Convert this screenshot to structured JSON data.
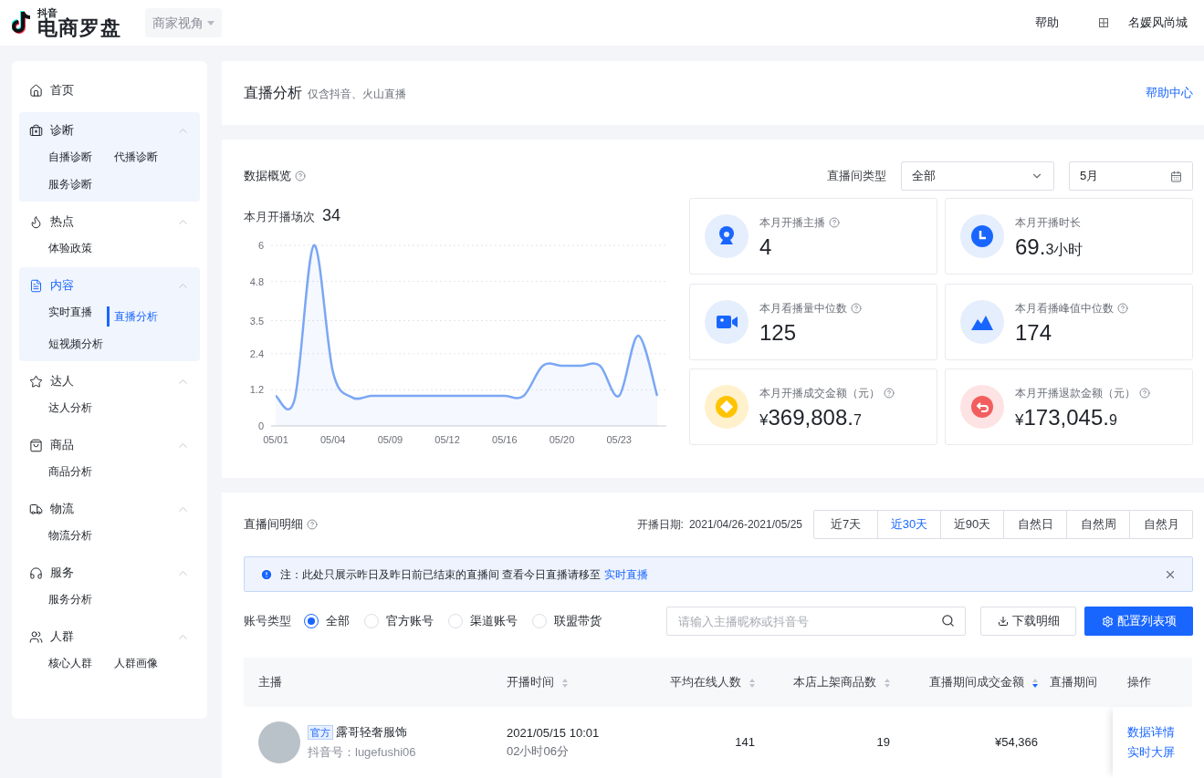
{
  "topbar": {
    "logo_small": "抖音",
    "logo_title": "电商罗盘",
    "view_selector": "商家视角",
    "help": "帮助",
    "shop_name": "名媛风尚城"
  },
  "sidebar": {
    "groups": [
      {
        "kind": "home",
        "label": "首页",
        "selected": false,
        "highlighted": false
      },
      {
        "kind": "diagnose",
        "label": "诊断",
        "selected": false,
        "highlighted": true,
        "expanded": true,
        "children": [
          {
            "label": "自播诊断",
            "selected": false
          },
          {
            "label": "代播诊断",
            "selected": false
          },
          {
            "label": "服务诊断",
            "selected": false
          }
        ]
      },
      {
        "kind": "hot",
        "label": "热点",
        "selected": false,
        "highlighted": false,
        "expanded": true,
        "children": [
          {
            "label": "体验政策",
            "selected": false
          }
        ]
      },
      {
        "kind": "content",
        "label": "内容",
        "selected": true,
        "highlighted": true,
        "expanded": true,
        "children": [
          {
            "label": "实时直播",
            "selected": false
          },
          {
            "label": "直播分析",
            "selected": true
          },
          {
            "label": "短视频分析",
            "selected": false
          }
        ]
      },
      {
        "kind": "talent",
        "label": "达人",
        "selected": false,
        "highlighted": false,
        "expanded": true,
        "children": [
          {
            "label": "达人分析",
            "selected": false
          }
        ]
      },
      {
        "kind": "goods",
        "label": "商品",
        "selected": false,
        "highlighted": false,
        "expanded": true,
        "children": [
          {
            "label": "商品分析",
            "selected": false
          }
        ]
      },
      {
        "kind": "logistics",
        "label": "物流",
        "selected": false,
        "highlighted": false,
        "expanded": true,
        "children": [
          {
            "label": "物流分析",
            "selected": false
          }
        ]
      },
      {
        "kind": "service",
        "label": "服务",
        "selected": false,
        "highlighted": false,
        "expanded": true,
        "children": [
          {
            "label": "服务分析",
            "selected": false
          }
        ]
      },
      {
        "kind": "crowd",
        "label": "人群",
        "selected": false,
        "highlighted": false,
        "expanded": true,
        "children": [
          {
            "label": "核心人群",
            "selected": false
          },
          {
            "label": "人群画像",
            "selected": false
          }
        ]
      }
    ]
  },
  "header": {
    "title": "直播分析",
    "subtitle": "仅含抖音、火山直播",
    "help_link": "帮助中心"
  },
  "overview": {
    "title": "数据概览",
    "room_type_label": "直播间类型",
    "room_type_value": "全部",
    "month_value": "5月",
    "sessions_label": "本月开播场次",
    "sessions_value": "34",
    "chart_data": {
      "type": "area",
      "grid": true,
      "categories": [
        "05/01",
        null,
        null,
        "05/04",
        null,
        null,
        "05/09",
        null,
        null,
        "05/12",
        null,
        null,
        "05/16",
        null,
        null,
        "05/20",
        null,
        null,
        "05/23",
        null,
        null
      ],
      "yticks": [
        0,
        {
          "value": 1.2,
          "label": "1.2"
        },
        {
          "value": 2.4,
          "label": "2.4"
        },
        {
          "value": 3.5,
          "label": "3.5"
        },
        {
          "value": 4.8,
          "label": "4.8"
        },
        6
      ],
      "ylim": [
        0,
        6
      ],
      "series": [
        {
          "color": "#7ba7f5",
          "values": [
            1,
            0.9,
            6,
            1.8,
            0.95,
            1,
            1,
            1,
            1,
            1,
            1,
            1,
            1,
            1,
            2,
            2,
            2,
            2,
            1,
            3,
            1
          ]
        }
      ]
    },
    "stats": [
      {
        "kind": "anchor",
        "color": "#1966ff",
        "label": "本月开播主播",
        "help": true,
        "value": "4"
      },
      {
        "kind": "clock",
        "color": "#1966ff",
        "label": "本月开播时长",
        "help": false,
        "value": "69.",
        "small": "3小时"
      },
      {
        "kind": "video",
        "color": "#1966ff",
        "label": "本月看播量中位数",
        "help": true,
        "value": "125"
      },
      {
        "kind": "peak",
        "color": "#1966ff",
        "label": "本月看播峰值中位数",
        "help": true,
        "value": "174"
      },
      {
        "kind": "coin",
        "color": "#ffc300",
        "label": "本月开播成交金额（元）",
        "help": true,
        "prefix": "¥",
        "value": "369,808.",
        "small": "7"
      },
      {
        "kind": "refund",
        "color": "#f25e5e",
        "label": "本月开播退款金额（元）",
        "help": true,
        "prefix": "¥",
        "value": "173,045.",
        "small": "9"
      }
    ]
  },
  "detail": {
    "title": "直播间明细",
    "date_label": "开播日期:",
    "date_range": "2021/04/26-2021/05/25",
    "ranges": [
      {
        "label": "近7天",
        "selected": false
      },
      {
        "label": "近30天",
        "selected": true
      },
      {
        "label": "近90天",
        "selected": false
      },
      {
        "label": "自然日",
        "selected": false
      },
      {
        "label": "自然周",
        "selected": false
      },
      {
        "label": "自然月",
        "selected": false
      }
    ],
    "notice": {
      "text": "注：此处只展示昨日及昨日前已结束的直播间 查看今日直播请移至",
      "link": "实时直播"
    },
    "account_label": "账号类型",
    "account_types": [
      {
        "label": "全部",
        "selected": true
      },
      {
        "label": "官方账号",
        "selected": false
      },
      {
        "label": "渠道账号",
        "selected": false
      },
      {
        "label": "联盟带货",
        "selected": false
      }
    ],
    "search_placeholder": "请输入主播昵称或抖音号",
    "download_button": "下载明细",
    "config_button": "配置列表项",
    "columns": [
      {
        "label": "主播",
        "sortable": false
      },
      {
        "label": "开播时间",
        "sortable": true,
        "sorted_desc": false
      },
      {
        "label": "平均在线人数",
        "sortable": true,
        "sorted_desc": false
      },
      {
        "label": "本店上架商品数",
        "sortable": true,
        "sorted_desc": false
      },
      {
        "label": "直播期间成交金额",
        "sortable": true,
        "sorted_desc": true
      },
      {
        "label": "直播期间",
        "sortable": false
      },
      {
        "label": "操作",
        "sortable": false
      }
    ],
    "rows": [
      {
        "badge": "官方",
        "name": "露哥轻奢服饰",
        "account": "抖音号：lugefushi06",
        "start_time": "2021/05/15 10:01",
        "duration": "02小时06分",
        "avg_online": "141",
        "goods_count": "19",
        "gmv": "¥54,366",
        "actions": [
          "数据详情",
          "实时大屏"
        ]
      }
    ]
  }
}
